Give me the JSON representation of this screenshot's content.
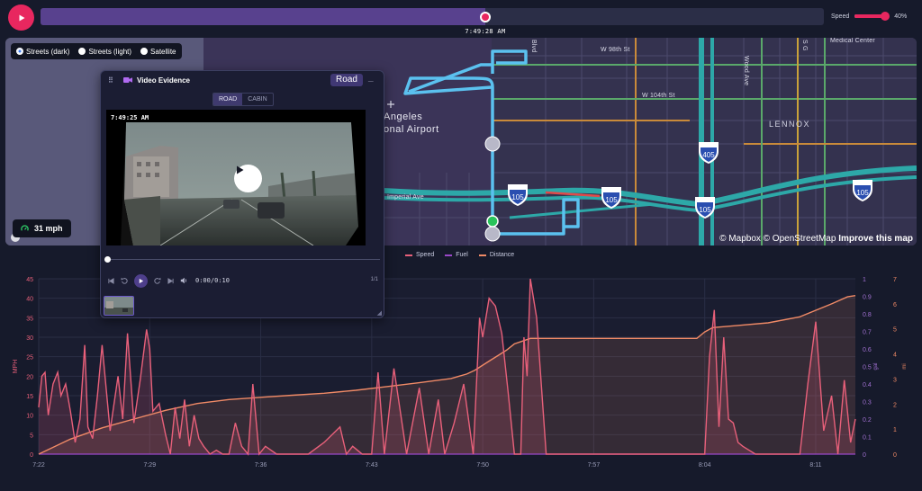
{
  "playback": {
    "play_icon": "play-icon",
    "progress": 0.5677,
    "current_time": "7:49:28 AM",
    "speed_label": "Speed",
    "speed_value": "40%",
    "speed_fraction": 0.4
  },
  "map": {
    "layers": [
      {
        "label": "Streets (dark)",
        "selected": true
      },
      {
        "label": "Streets (light)",
        "selected": false
      },
      {
        "label": "Satellite",
        "selected": false
      }
    ],
    "place_labels": {
      "w98": "W 98th St",
      "w104": "W 104th St",
      "imperial": "Imperial Ave",
      "lennox": "LENNOX",
      "medical": "Medical Center",
      "airport_1": "Angeles",
      "airport_2": "onal Airport",
      "wood": "Wood Ave",
      "blvd": "Blvd",
      "s_g": "S G"
    },
    "shields": [
      "405",
      "105",
      "105",
      "105",
      "105"
    ],
    "attribution": "© Mapbox © OpenStreetMap",
    "improve_link": "Improve this map",
    "speed_badge": "31 mph",
    "speed_icon": "gauge-icon",
    "colors": {
      "route": "#5bc1ef",
      "freeway": "#2da8a8",
      "start": "#29c35a"
    }
  },
  "video_panel": {
    "title": "Video Evidence",
    "drag_icon": "drag-handle-icon",
    "camera_icon": "camera-icon",
    "mode_badge": "Road",
    "minimize_label": "_",
    "tabs": [
      {
        "label": "ROAD",
        "active": true
      },
      {
        "label": "CABIN",
        "active": false
      }
    ],
    "timestamp": "7:49:25 AM",
    "time_display": "0:00/0:10",
    "clip_count": "1/1",
    "controls": [
      "skip-back-icon",
      "rewind-icon",
      "play-icon",
      "forward-icon",
      "skip-forward-icon",
      "volume-icon"
    ]
  },
  "chart_data": {
    "type": "line",
    "legend": [
      "Speed",
      "Fuel",
      "Distance"
    ],
    "colors": {
      "Speed": "#e8607a",
      "Fuel": "#9a48c8",
      "Distance": "#f08a66"
    },
    "x_ticks": [
      "7:22",
      "7:29",
      "7:36",
      "7:43",
      "7:50",
      "7:57",
      "8:04",
      "8:11"
    ],
    "x_range_minutes": [
      0,
      51.5
    ],
    "y_left": {
      "label": "MPH",
      "ticks": [
        0,
        5,
        10,
        15,
        20,
        25,
        30,
        35,
        40,
        45
      ],
      "range": [
        0,
        45
      ]
    },
    "y_right_1": {
      "label": "gal",
      "ticks": [
        "0",
        "0.1",
        "0.2",
        "0.3",
        "0.4",
        "0.5",
        "0.6",
        "0.7",
        "0.8",
        "0.9",
        "1"
      ],
      "range": [
        0,
        1
      ]
    },
    "y_right_2": {
      "label": "mi",
      "ticks": [
        0,
        1,
        2,
        3,
        4,
        5,
        6,
        7
      ],
      "range": [
        0,
        7
      ]
    },
    "series": [
      {
        "name": "Speed",
        "x": [
          0,
          0.2,
          0.4,
          0.6,
          0.9,
          1.2,
          1.4,
          1.7,
          2.0,
          2.3,
          2.6,
          2.9,
          3.1,
          3.4,
          3.7,
          4.0,
          4.5,
          5.0,
          5.3,
          5.6,
          6.0,
          6.4,
          6.8,
          7.0,
          7.2,
          7.6,
          8.0,
          8.3,
          8.6,
          8.9,
          9.2,
          9.5,
          9.8,
          10.1,
          10.4,
          10.8,
          11.2,
          11.6,
          12.0,
          12.4,
          12.8,
          13.2,
          13.5,
          13.9,
          14.3,
          15.0,
          16.0,
          17.0,
          18.0,
          19.0,
          19.4,
          19.8,
          20.4,
          21.0,
          21.4,
          21.8,
          22.4,
          23.2,
          24.0,
          24.6,
          25.2,
          25.6,
          26.2,
          26.8,
          27.4,
          27.8,
          28.0,
          28.4,
          28.8,
          29.2,
          29.6,
          30.0,
          30.4,
          30.6,
          30.8,
          31.0,
          31.4,
          32.0,
          35.0,
          38.0,
          40.0,
          42.0,
          42.3,
          42.6,
          42.9,
          43.2,
          43.5,
          43.8,
          44.1,
          44.4,
          44.8,
          45.2,
          46.0,
          47.0,
          48.0,
          48.5,
          49.0,
          49.5,
          50.0,
          50.4,
          50.8,
          51.2,
          51.5
        ],
        "y": [
          12,
          20,
          21,
          10,
          18,
          21,
          15,
          18,
          11,
          3,
          9,
          28,
          7,
          4,
          15,
          28,
          6,
          20,
          9,
          31,
          8,
          19,
          32,
          27,
          11,
          13,
          5,
          0,
          12,
          4,
          14,
          2,
          10,
          4,
          2,
          0,
          1,
          0,
          0,
          8,
          2,
          0,
          18,
          0,
          2,
          0,
          0,
          0,
          3,
          7,
          0,
          2,
          0,
          0,
          21,
          0,
          22,
          0,
          17,
          0,
          14,
          0,
          8,
          18,
          0,
          35,
          30,
          40,
          38,
          31,
          16,
          0,
          0,
          30,
          20,
          50,
          35,
          0,
          0,
          0,
          0,
          0,
          25,
          37,
          7,
          30,
          9,
          8,
          3,
          2,
          1,
          0,
          0,
          0,
          0,
          18,
          34,
          6,
          15,
          0,
          19,
          3,
          9
        ]
      },
      {
        "name": "Distance",
        "x": [
          0,
          2,
          4,
          6,
          8,
          10,
          12,
          14,
          16,
          18,
          20,
          22,
          24,
          26,
          27,
          27.5,
          28,
          28.5,
          29,
          29.5,
          30,
          31,
          34,
          37,
          40,
          41.5,
          42,
          42.5,
          44,
          46,
          48,
          50,
          51,
          51.5
        ],
        "y": [
          0,
          0.6,
          1.05,
          1.4,
          1.75,
          2.02,
          2.18,
          2.27,
          2.35,
          2.43,
          2.55,
          2.7,
          2.85,
          3.02,
          3.2,
          3.35,
          3.55,
          3.75,
          3.95,
          4.15,
          4.4,
          4.62,
          4.62,
          4.62,
          4.62,
          4.62,
          4.88,
          5.05,
          5.13,
          5.24,
          5.48,
          6.0,
          6.28,
          6.33
        ]
      },
      {
        "name": "Fuel",
        "x": [
          0,
          51.5
        ],
        "y": [
          0,
          0
        ]
      }
    ]
  }
}
